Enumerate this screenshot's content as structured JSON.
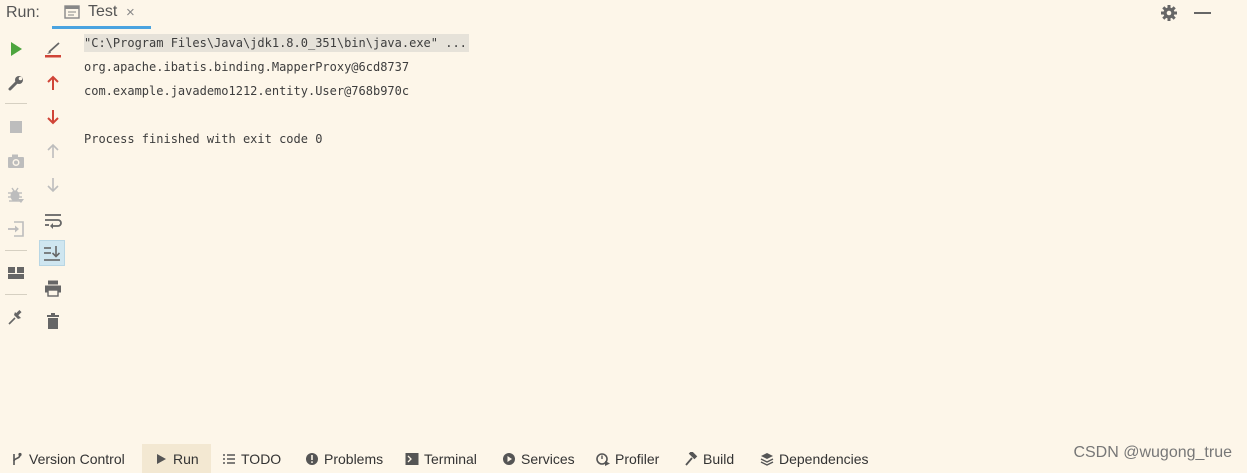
{
  "header": {
    "run_label": "Run:",
    "tab_label": "Test",
    "close_glyph": "×"
  },
  "toolbar_icons": {
    "left": [
      "run-icon",
      "wrench-icon",
      "stop-icon",
      "camera-icon",
      "debug-icon",
      "login-icon",
      "layout-icon",
      "pin-icon"
    ],
    "right": [
      "clear-icon",
      "arrow-up-icon",
      "arrow-down-icon",
      "arrow-up-disabled-icon",
      "arrow-down-disabled-icon",
      "soft-wrap-icon",
      "scroll-to-end-icon",
      "print-icon",
      "trash-icon"
    ]
  },
  "console": {
    "lines": [
      "\"C:\\Program Files\\Java\\jdk1.8.0_351\\bin\\java.exe\" ...",
      "org.apache.ibatis.binding.MapperProxy@6cd8737",
      "com.example.javademo1212.entity.User@768b970c",
      "",
      "Process finished with exit code 0"
    ]
  },
  "bottom_bar": {
    "items": [
      {
        "label": "Version Control",
        "icon": "branch-icon"
      },
      {
        "label": "Run",
        "icon": "run-icon"
      },
      {
        "label": "TODO",
        "icon": "list-icon"
      },
      {
        "label": "Problems",
        "icon": "problems-icon"
      },
      {
        "label": "Terminal",
        "icon": "terminal-icon"
      },
      {
        "label": "Services",
        "icon": "services-icon"
      },
      {
        "label": "Profiler",
        "icon": "profiler-icon"
      },
      {
        "label": "Build",
        "icon": "hammer-icon"
      },
      {
        "label": "Dependencies",
        "icon": "dependencies-icon"
      }
    ],
    "watermark": "CSDN @wugong_true"
  },
  "colors": {
    "background": "#fdf6e9",
    "accent": "#4aa3e0",
    "run_green": "#4da53e",
    "red": "#d04437"
  }
}
